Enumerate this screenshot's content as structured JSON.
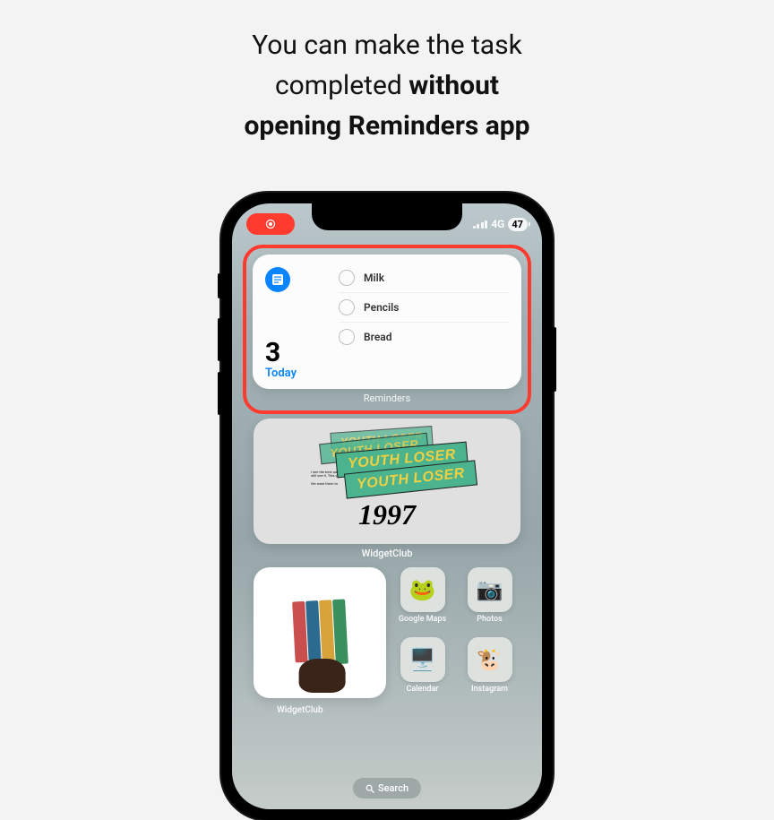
{
  "headline": {
    "line1": "You can make the task",
    "line2_normal": "completed ",
    "line2_bold": "without",
    "line3_bold": "opening Reminders app"
  },
  "status": {
    "network": "4G",
    "battery": "47"
  },
  "reminders": {
    "count": "3",
    "today_label": "Today",
    "widget_name": "Reminders",
    "tasks": [
      "Milk",
      "Pencils",
      "Bread"
    ]
  },
  "widgetclub": {
    "sticker_text": "YOUTH LOSER",
    "year": "1997",
    "label": "WidgetClub"
  },
  "apps": {
    "big": "WidgetClub",
    "items": [
      {
        "label": "Google Maps",
        "emoji": "🐸"
      },
      {
        "label": "Photos",
        "emoji": "📷"
      },
      {
        "label": "Calendar",
        "emoji": "🖥️"
      },
      {
        "label": "Instagram",
        "emoji": "🐮"
      }
    ]
  },
  "search": {
    "label": "Search"
  }
}
